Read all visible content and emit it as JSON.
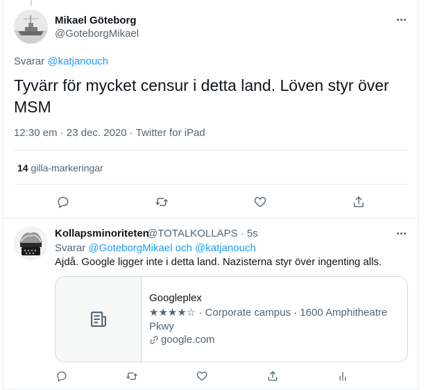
{
  "tweet": {
    "author_name": "Mikael Göteborg",
    "author_handle": "@GoteborgMikael",
    "replying_prefix": "Svarar",
    "replying_to": "@katjanouch",
    "text": "Tyvärr för mycket censur i detta land. Löven styr över MSM",
    "time": "12:30 em",
    "date": "23 dec. 2020",
    "separator": "·",
    "source": "Twitter for iPad",
    "likes_count": "14",
    "likes_label": "gilla-markeringar"
  },
  "reply": {
    "author_name": "Kollapsminoriteten",
    "author_handle": "@TOTALKOLLAPS",
    "separator": "·",
    "age": "5s",
    "replying_prefix": "Svarar",
    "replying_to_1": "@GoteborgMikael",
    "replying_and": "och",
    "replying_to_2": "@katjanouch",
    "text": "Ajdå. Google ligger inte i detta land. Nazisterna styr över ingenting alls.",
    "card": {
      "title": "Googleplex",
      "description": "★★★★☆ · Corporate campus · 1600 Amphitheatre Pkwy",
      "domain": "google.com"
    }
  },
  "icons": {
    "reply": "reply-icon",
    "retweet": "retweet-icon",
    "like": "heart-icon",
    "share": "share-icon",
    "analytics": "analytics-icon",
    "more": "more-icon",
    "link": "link-icon",
    "article": "article-icon"
  },
  "colors": {
    "link": "#1d9bf0",
    "secondary_text": "#536471",
    "primary_text": "#0f1419",
    "border": "#e6ecf0"
  }
}
